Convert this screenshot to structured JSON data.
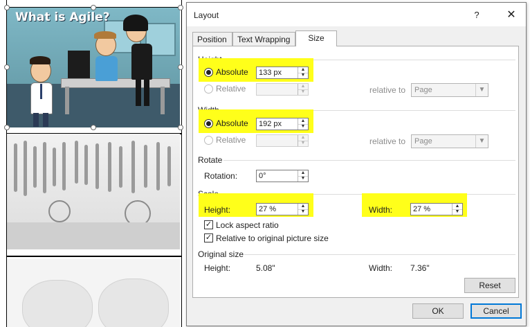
{
  "background_document": {
    "agile_image_title": "What is Agile?"
  },
  "dialog": {
    "title": "Layout",
    "help_label": "?",
    "close_icon": "close-icon",
    "tabs": [
      {
        "label": "Position"
      },
      {
        "label": "Text Wrapping"
      },
      {
        "label": "Size"
      }
    ],
    "active_tab": "Size",
    "height": {
      "group_label": "Height",
      "absolute_label": "Absolute",
      "absolute_value": "133 px",
      "absolute_selected": true,
      "relative_label": "Relative",
      "relative_value": "",
      "relative_to_label": "relative to",
      "relative_to_value": "Page"
    },
    "width": {
      "group_label": "Width",
      "absolute_label": "Absolute",
      "absolute_value": "192 px",
      "absolute_selected": true,
      "relative_label": "Relative",
      "relative_value": "",
      "relative_to_label": "relative to",
      "relative_to_value": "Page"
    },
    "rotate": {
      "group_label": "Rotate",
      "rotation_label": "Rotation:",
      "rotation_value": "0°"
    },
    "scale": {
      "group_label": "Scale",
      "height_label": "Height:",
      "height_value": "27 %",
      "width_label": "Width:",
      "width_value": "27 %",
      "lock_aspect_label": "Lock aspect ratio",
      "lock_aspect_checked": true,
      "relative_original_label": "Relative to original picture size",
      "relative_original_checked": true
    },
    "original_size": {
      "group_label": "Original size",
      "height_label": "Height:",
      "height_value": "5.08\"",
      "width_label": "Width:",
      "width_value": "7.36\""
    },
    "buttons": {
      "reset": "Reset",
      "ok": "OK",
      "cancel": "Cancel"
    },
    "highlight_color": "#ffff1a",
    "accent_color": "#0078d7"
  }
}
